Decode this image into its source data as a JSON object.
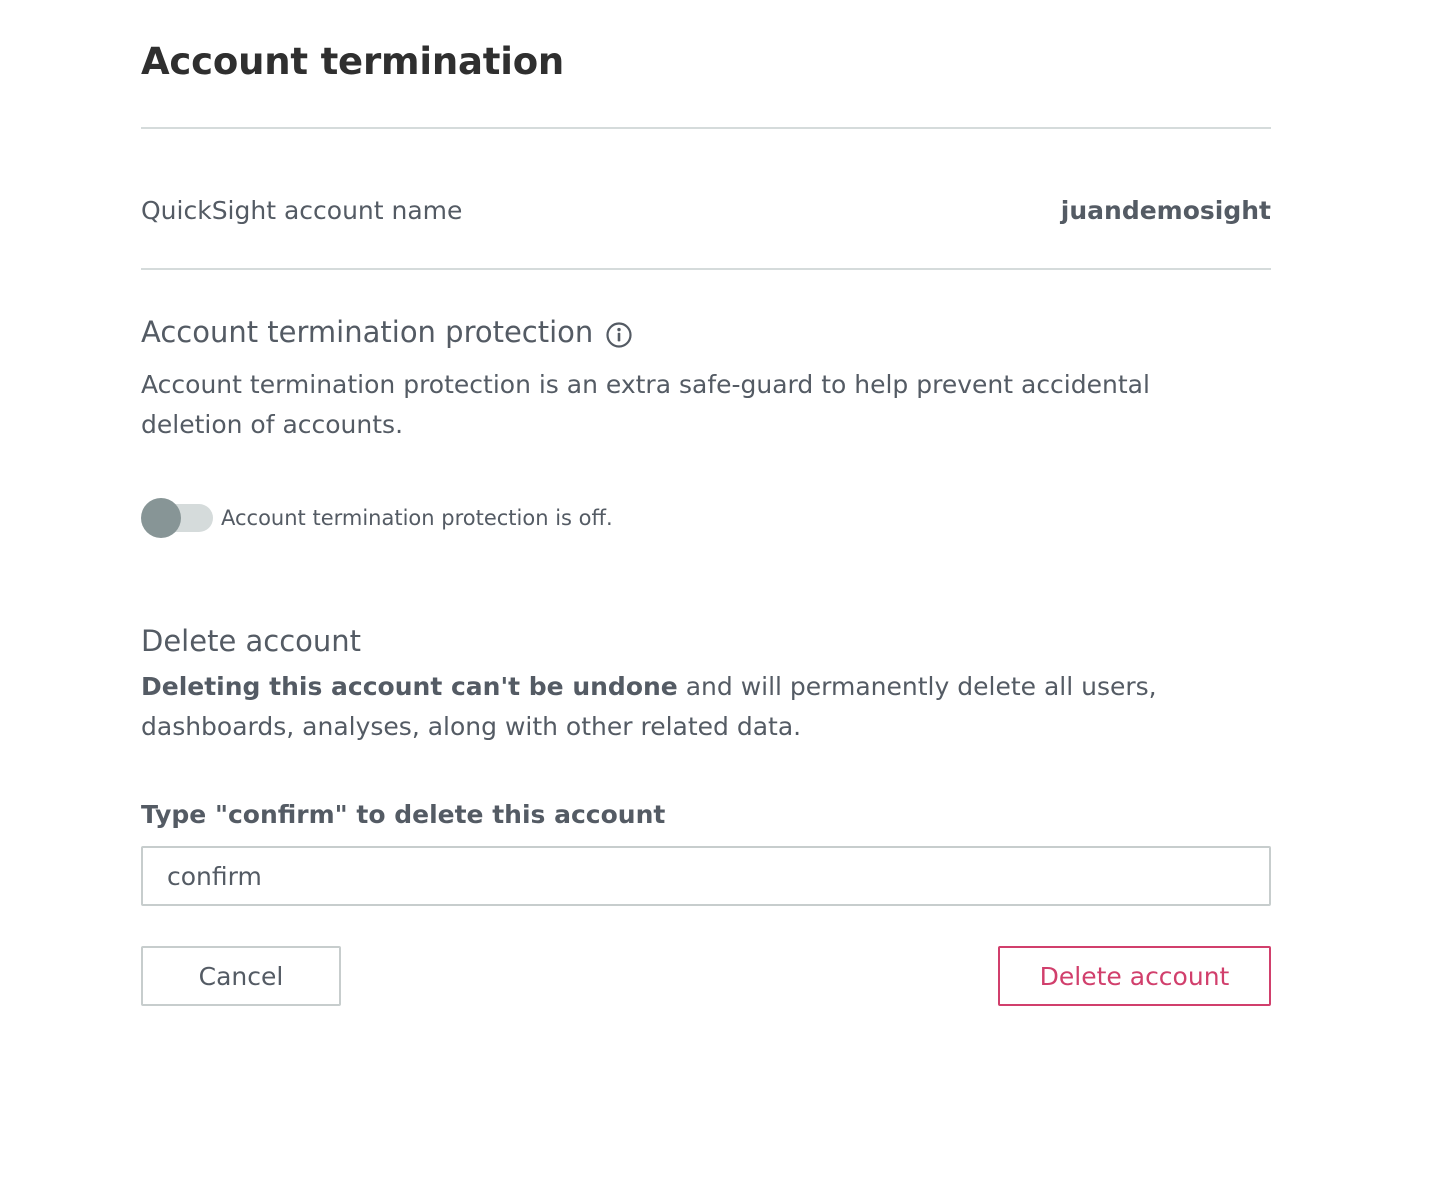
{
  "page": {
    "title": "Account termination"
  },
  "account": {
    "label": "QuickSight account name",
    "value": "juandemosight"
  },
  "protection": {
    "heading": "Account termination protection",
    "info_icon": "info-circle-icon",
    "description": "Account termination protection is an extra safe-guard to help prevent accidental deletion of accounts.",
    "toggle_on": false,
    "toggle_status": "Account termination protection is off."
  },
  "delete": {
    "heading": "Delete account",
    "warning_bold": "Deleting this account can't be undone",
    "warning_rest": " and will permanently delete all users, dashboards, analyses, along with other related data.",
    "confirm_label": "Type \"confirm\" to delete this account",
    "confirm_value": "confirm"
  },
  "actions": {
    "cancel_label": "Cancel",
    "delete_label": "Delete account"
  },
  "colors": {
    "danger": "#d13f6c",
    "text": "#545b64",
    "divider": "#d5dbdb",
    "toggle_knob_off": "#879596"
  }
}
